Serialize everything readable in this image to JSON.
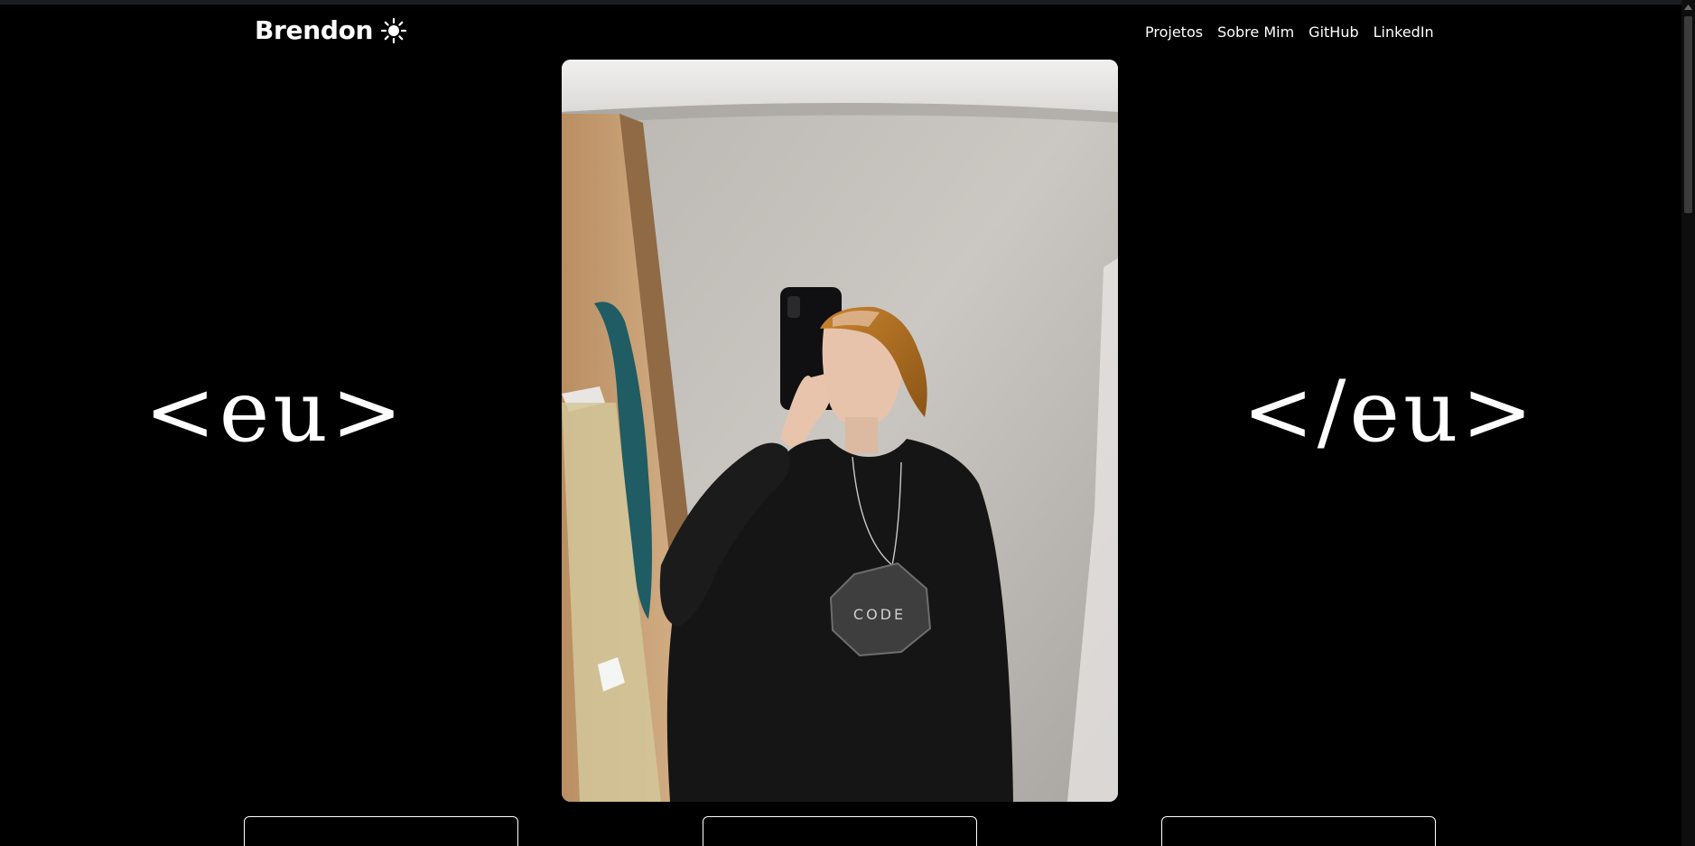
{
  "brand": {
    "name": "Brendon",
    "theme_toggle_icon": "sun-icon"
  },
  "nav": {
    "links": [
      {
        "label": "Projetos"
      },
      {
        "label": "Sobre Mim"
      },
      {
        "label": "GitHub"
      },
      {
        "label": "LinkedIn"
      }
    ]
  },
  "hero": {
    "open_tag": "<eu>",
    "close_tag": "</eu>",
    "photo_icon": "profile-photo"
  },
  "colors": {
    "background": "#000000",
    "text": "#ffffff",
    "card_border": "#ffffff"
  }
}
